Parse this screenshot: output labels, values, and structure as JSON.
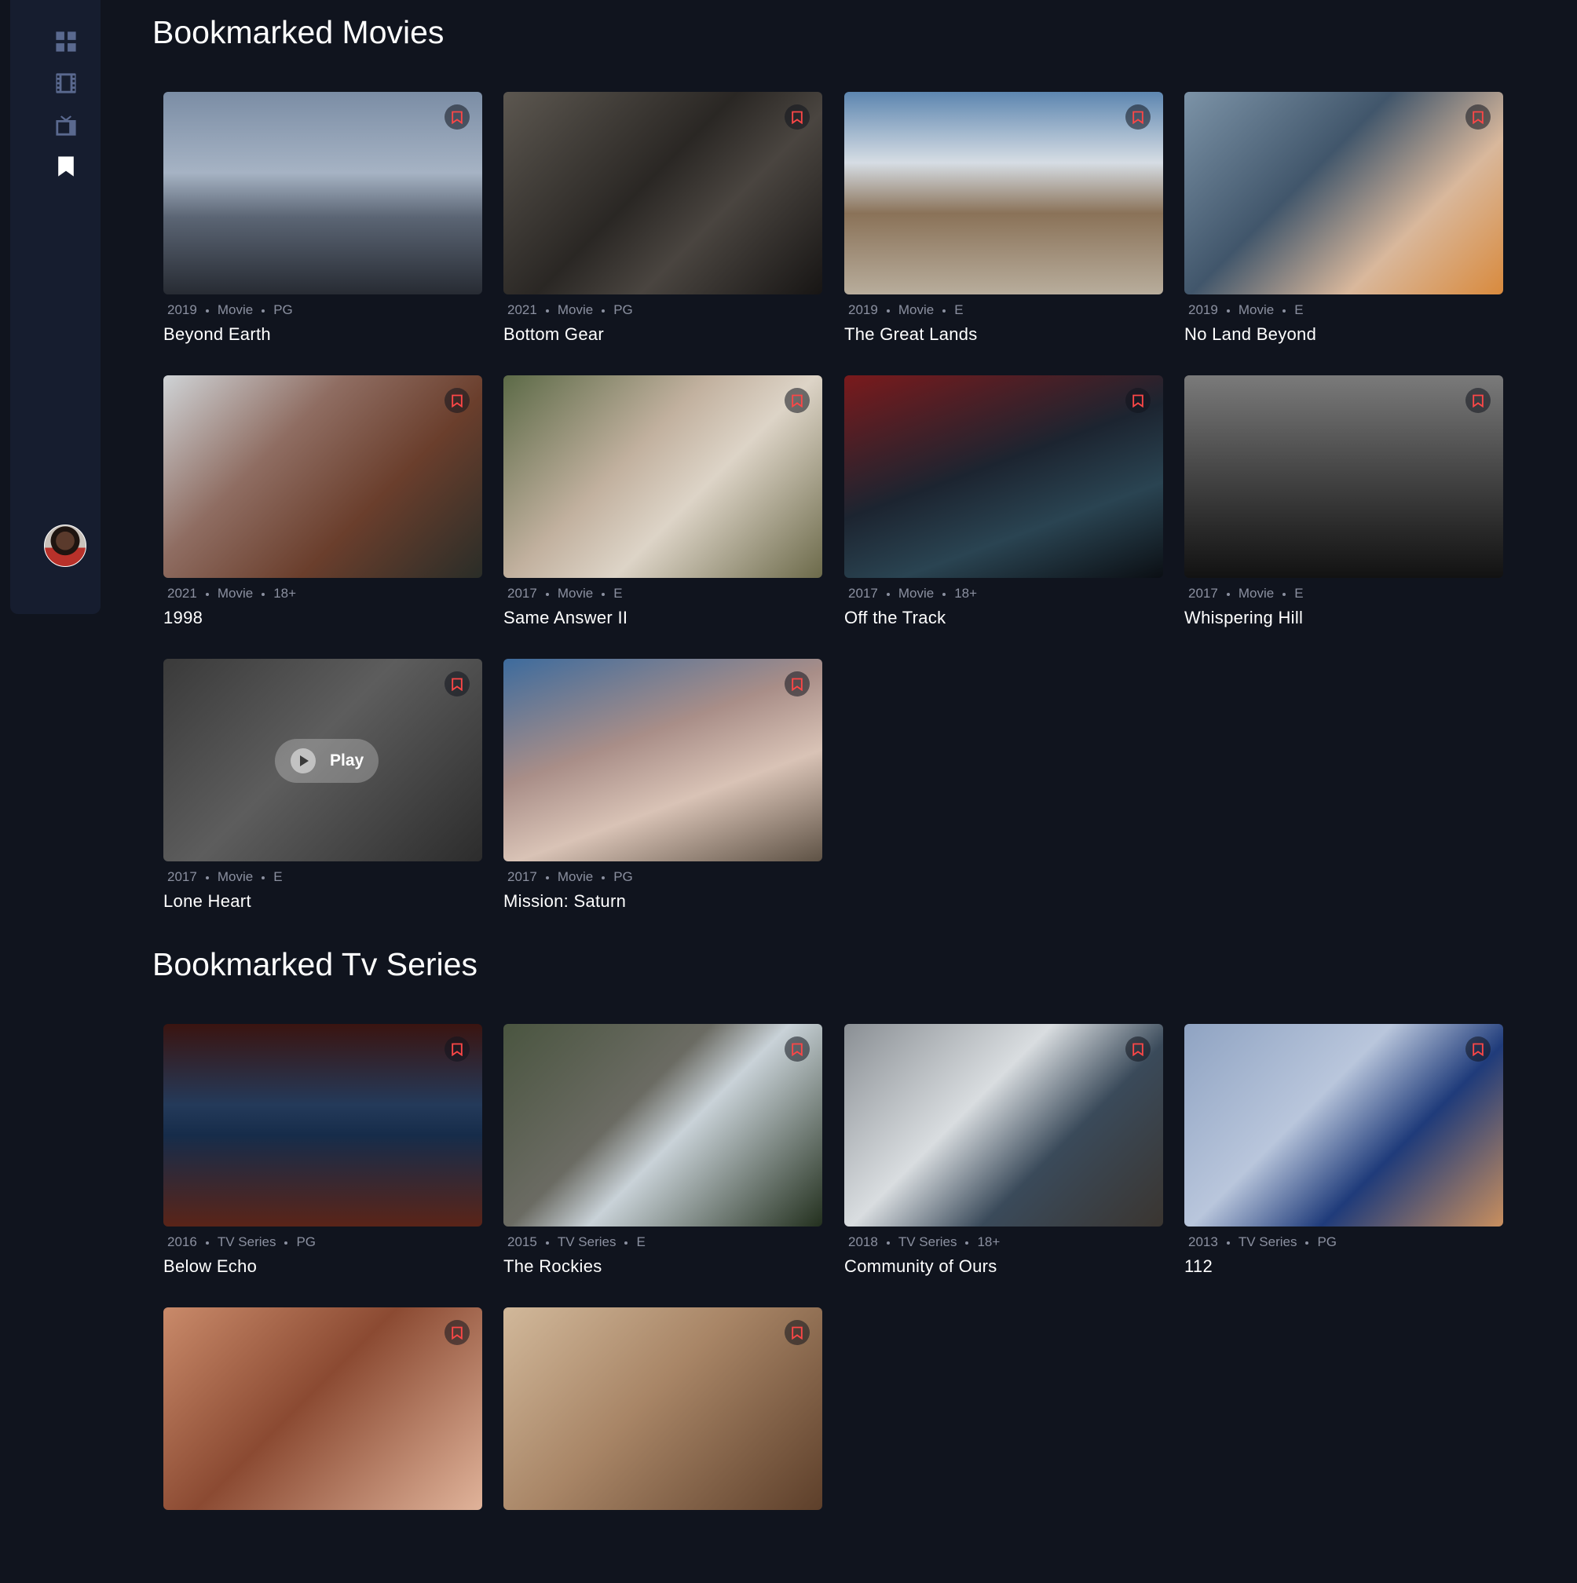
{
  "nav": {
    "items": [
      {
        "name": "nav-home-icon",
        "icon": "grid-icon"
      },
      {
        "name": "nav-movies-icon",
        "icon": "film-icon"
      },
      {
        "name": "nav-tv-icon",
        "icon": "tv-icon"
      },
      {
        "name": "nav-bookmarks-icon",
        "icon": "bookmark-icon",
        "active": true
      }
    ]
  },
  "colors": {
    "background": "#10141e",
    "sidebar": "#161d2f",
    "accent": "#fc4747",
    "muted": "#5a698f"
  },
  "movies": {
    "title": "Bookmarked Movies",
    "items": [
      {
        "year": "2019",
        "category": "Movie",
        "rating": "PG",
        "title": "Beyond Earth"
      },
      {
        "year": "2021",
        "category": "Movie",
        "rating": "PG",
        "title": "Bottom Gear"
      },
      {
        "year": "2019",
        "category": "Movie",
        "rating": "E",
        "title": "The Great Lands"
      },
      {
        "year": "2019",
        "category": "Movie",
        "rating": "E",
        "title": "No Land Beyond"
      },
      {
        "year": "2021",
        "category": "Movie",
        "rating": "18+",
        "title": "1998"
      },
      {
        "year": "2017",
        "category": "Movie",
        "rating": "E",
        "title": "Same Answer II"
      },
      {
        "year": "2017",
        "category": "Movie",
        "rating": "18+",
        "title": "Off the Track"
      },
      {
        "year": "2017",
        "category": "Movie",
        "rating": "E",
        "title": "Whispering Hill"
      },
      {
        "year": "2017",
        "category": "Movie",
        "rating": "E",
        "title": "Lone Heart",
        "play": "Play"
      },
      {
        "year": "2017",
        "category": "Movie",
        "rating": "PG",
        "title": "Mission: Saturn"
      }
    ]
  },
  "series": {
    "title": "Bookmarked Tv Series",
    "items": [
      {
        "year": "2016",
        "category": "TV Series",
        "rating": "PG",
        "title": "Below Echo"
      },
      {
        "year": "2015",
        "category": "TV Series",
        "rating": "E",
        "title": "The Rockies"
      },
      {
        "year": "2018",
        "category": "TV Series",
        "rating": "18+",
        "title": "Community of Ours"
      },
      {
        "year": "2013",
        "category": "TV Series",
        "rating": "PG",
        "title": "112"
      }
    ]
  }
}
